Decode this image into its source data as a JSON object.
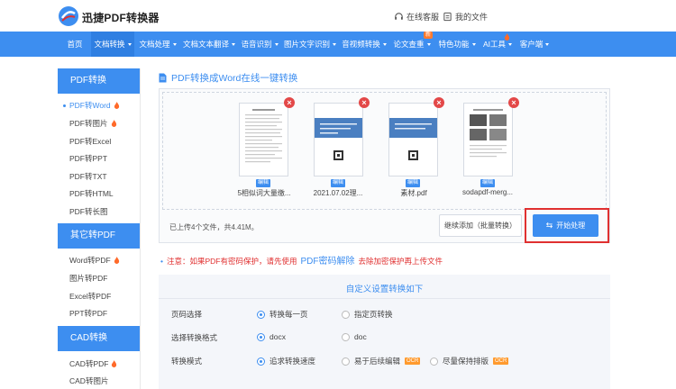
{
  "header": {
    "logo_text": "迅捷PDF转换器",
    "service_label": "在线客服",
    "files_label": "我的文件"
  },
  "nav": {
    "items": [
      {
        "label": "首页"
      },
      {
        "label": "文档转换"
      },
      {
        "label": "文档处理"
      },
      {
        "label": "文档文本翻译"
      },
      {
        "label": "语音识别"
      },
      {
        "label": "图片文字识别"
      },
      {
        "label": "音视频转换"
      },
      {
        "label": "论文查重"
      },
      {
        "label": "特色功能"
      },
      {
        "label": "AI工具"
      },
      {
        "label": "客户端"
      }
    ],
    "new_badge": "新"
  },
  "sidebar": {
    "pdf_section": "PDF转换",
    "pdf_items": [
      "PDF转Word",
      "PDF转图片",
      "PDF转Excel",
      "PDF转PPT",
      "PDF转TXT",
      "PDF转HTML",
      "PDF转长图"
    ],
    "other_section": "其它转PDF",
    "other_items": [
      "Word转PDF",
      "图片转PDF",
      "Excel转PDF",
      "PPT转PDF"
    ],
    "cad_section": "CAD转换",
    "cad_items": [
      "CAD转PDF",
      "CAD转图片"
    ]
  },
  "main": {
    "title": "PDF转换成Word在线一键转换",
    "files": [
      {
        "name": "5相似词大量缴..."
      },
      {
        "name": "2021.07.02理..."
      },
      {
        "name": "素材.pdf"
      },
      {
        "name": "sodapdf-merg..."
      }
    ],
    "edit_label": "编辑",
    "uploaded_info": "已上传4个文件，共4.41M。",
    "continue_button": "继续添加（批量转换）",
    "start_button": "开始处理"
  },
  "notice": {
    "prefix": "注意：如果PDF有密码保护，请先使用",
    "link": "PDF密码解除",
    "suffix": "去除加密保护再上传文件"
  },
  "settings": {
    "title": "自定义设置转换如下",
    "rows": [
      {
        "label": "页码选择",
        "options": [
          "转换每一页",
          "指定页转换"
        ]
      },
      {
        "label": "选择转换格式",
        "options": [
          "docx",
          "doc"
        ]
      },
      {
        "label": "转换模式",
        "options": [
          "追求转换速度",
          "易于后续编辑",
          "尽量保持排版"
        ]
      }
    ],
    "ocr_badge": "OCR"
  },
  "colors": {
    "primary": "#3d8ef0",
    "danger": "#e03030",
    "ocr": "#ff9a2e"
  }
}
